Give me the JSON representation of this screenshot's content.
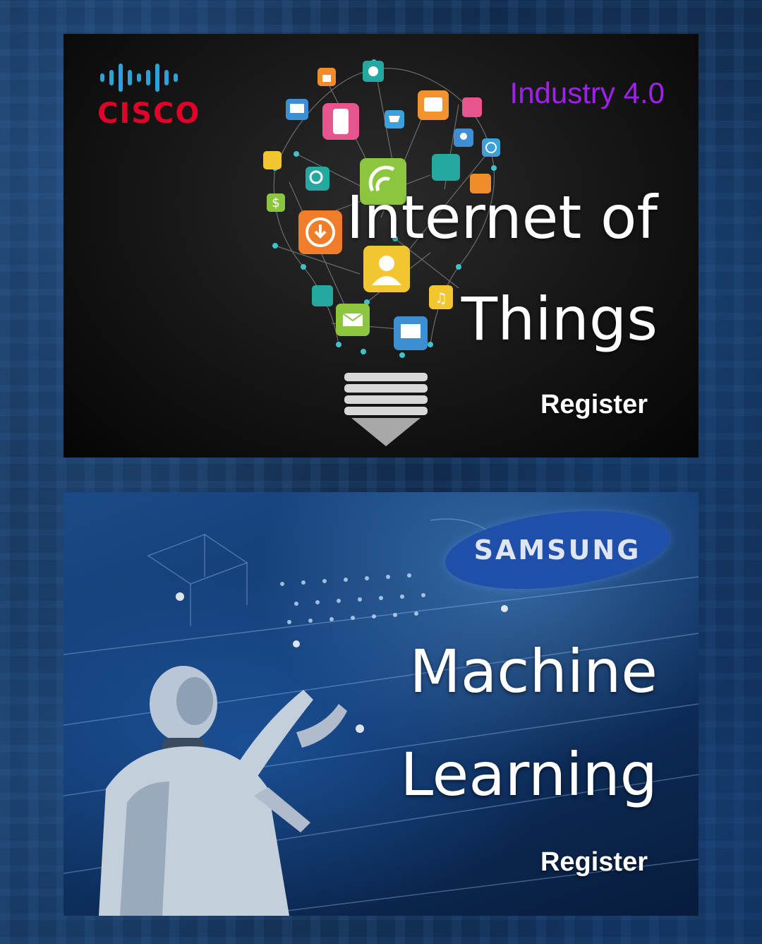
{
  "cards": [
    {
      "id": "iot",
      "brand": "CISCO",
      "tag": "Industry 4.0",
      "title_lines": [
        "Internet of",
        "Things"
      ],
      "register_label": "Register",
      "bulb_icons": [
        "lock-icon",
        "camera-icon",
        "phone-icon",
        "monitor-icon",
        "cart-icon",
        "tablet-icon",
        "call-icon",
        "location-icon",
        "target-icon",
        "satellite-icon",
        "search-icon",
        "wifi-icon",
        "network-icon",
        "dollar-icon",
        "download-icon",
        "user-icon",
        "music-icon",
        "mail-icon",
        "computer-icon",
        "chart-icon"
      ]
    },
    {
      "id": "ml",
      "brand": "SAMSUNG",
      "title_lines": [
        "Machine",
        "Learning"
      ],
      "register_label": "Register"
    }
  ],
  "colors": {
    "cisco_red": "#e0002a",
    "cisco_blue": "#2aa3d6",
    "industry_purple": "#a020f0",
    "samsung_blue": "#1f4fa8",
    "title_white": "#ffffff"
  }
}
